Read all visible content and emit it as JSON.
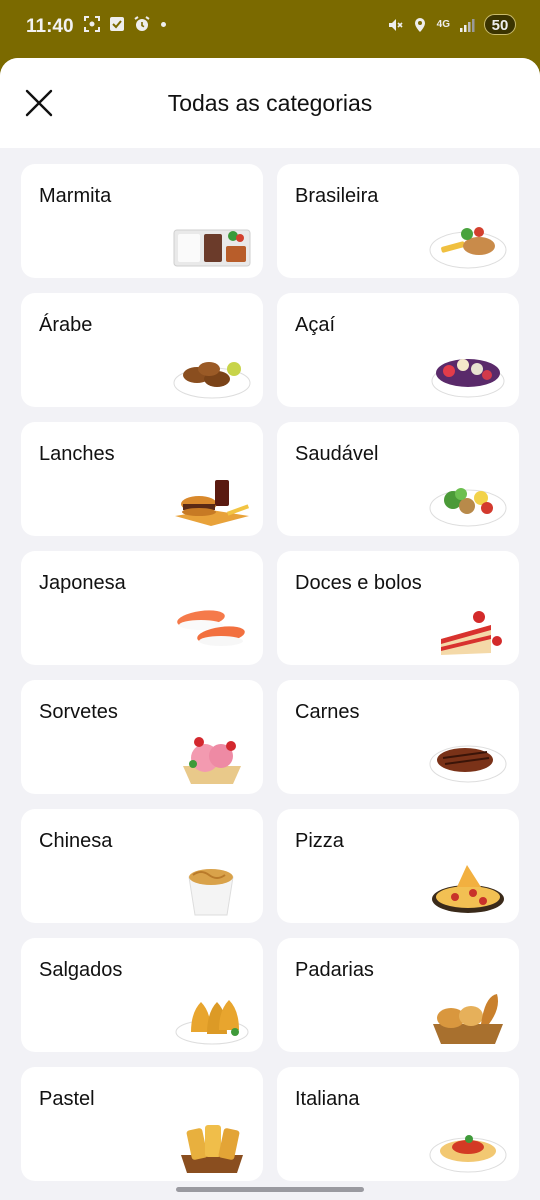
{
  "status_bar": {
    "time": "11:40",
    "network": "4G",
    "battery": "50",
    "left_icons": [
      "screenshot-icon",
      "checkbox-icon",
      "alarm-icon",
      "dot-icon"
    ],
    "right_icons": [
      "mute-icon",
      "location-icon",
      "network-4g-icon",
      "signal-icon",
      "battery-icon"
    ]
  },
  "header": {
    "title": "Todas as categorias",
    "close_icon": "close-icon"
  },
  "categories": [
    {
      "label": "Marmita",
      "icon": "marmita-food-image"
    },
    {
      "label": "Brasileira",
      "icon": "brasileira-food-image"
    },
    {
      "label": "Árabe",
      "icon": "arabe-food-image"
    },
    {
      "label": "Açaí",
      "icon": "acai-food-image"
    },
    {
      "label": "Lanches",
      "icon": "lanches-food-image"
    },
    {
      "label": "Saudável",
      "icon": "saudavel-food-image"
    },
    {
      "label": "Japonesa",
      "icon": "japonesa-food-image"
    },
    {
      "label": "Doces e bolos",
      "icon": "doces-food-image"
    },
    {
      "label": "Sorvetes",
      "icon": "sorvetes-food-image"
    },
    {
      "label": "Carnes",
      "icon": "carnes-food-image"
    },
    {
      "label": "Chinesa",
      "icon": "chinesa-food-image"
    },
    {
      "label": "Pizza",
      "icon": "pizza-food-image"
    },
    {
      "label": "Salgados",
      "icon": "salgados-food-image"
    },
    {
      "label": "Padarias",
      "icon": "padarias-food-image"
    },
    {
      "label": "Pastel",
      "icon": "pastel-food-image"
    },
    {
      "label": "Italiana",
      "icon": "italiana-food-image"
    }
  ],
  "colors": {
    "status_bar_bg": "#7b6a00",
    "sheet_bg": "#f2f2f6",
    "card_bg": "#ffffff",
    "text": "#111111"
  }
}
